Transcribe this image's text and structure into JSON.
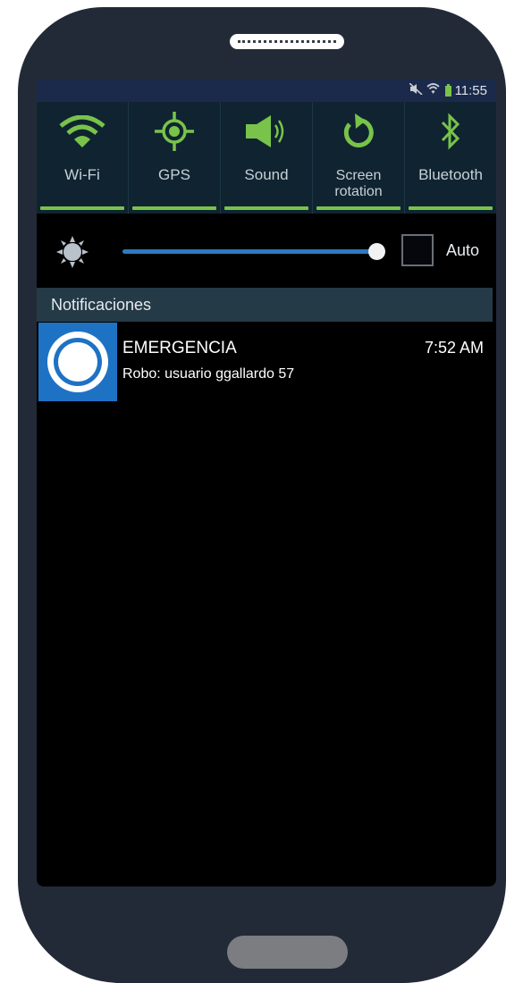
{
  "status_bar": {
    "time": "11:55",
    "icons": [
      "mute-icon",
      "wifi-icon",
      "battery-icon"
    ]
  },
  "quick_settings": [
    {
      "label": "Wi-Fi",
      "icon": "wifi-icon",
      "enabled": true
    },
    {
      "label": "GPS",
      "icon": "gps-icon",
      "enabled": true
    },
    {
      "label": "Sound",
      "icon": "sound-icon",
      "enabled": true
    },
    {
      "label": "Screen rotation",
      "icon": "rotation-icon",
      "enabled": true
    },
    {
      "label": "Bluetooth",
      "icon": "bluetooth-icon",
      "enabled": true
    }
  ],
  "brightness": {
    "icon": "brightness-icon",
    "level": 0.98,
    "auto_label": "Auto",
    "auto_checked": false
  },
  "notifications": {
    "header": "Notificaciones",
    "items": [
      {
        "title": "EMERGENCIA",
        "time": "7:52 AM",
        "text": "Robo: usuario ggallardo 57",
        "icon": "app-ring-icon"
      }
    ]
  },
  "colors": {
    "accent_green": "#79c34a",
    "slider_blue": "#2c7bbf",
    "app_icon_blue": "#1e72c4",
    "phone_body": "#232a37"
  }
}
